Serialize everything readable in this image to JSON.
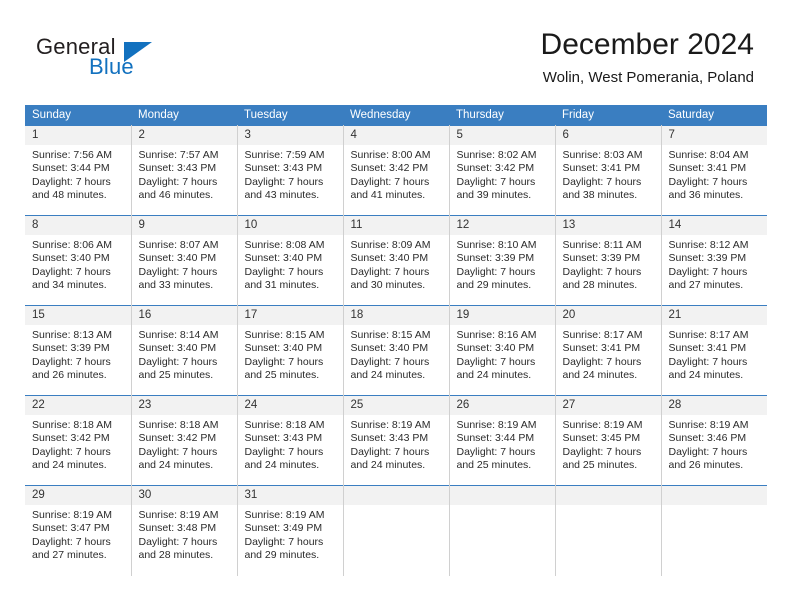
{
  "brand": {
    "name_part1": "General",
    "name_part2": "Blue",
    "triangle_icon": "triangle-icon",
    "color_dark": "#231f20",
    "color_blue": "#1271bf"
  },
  "header": {
    "title": "December 2024",
    "subtitle": "Wolin, West Pomerania, Poland"
  },
  "calendar": {
    "header_bg": "#3a7ec1",
    "daynum_bg": "#f2f2f2",
    "weekdays": [
      "Sunday",
      "Monday",
      "Tuesday",
      "Wednesday",
      "Thursday",
      "Friday",
      "Saturday"
    ],
    "labels": {
      "sunrise": "Sunrise:",
      "sunset": "Sunset:",
      "daylight": "Daylight:"
    },
    "weeks": [
      [
        {
          "day": "1",
          "sunrise": "Sunrise: 7:56 AM",
          "sunset": "Sunset: 3:44 PM",
          "daylight1": "Daylight: 7 hours",
          "daylight2": "and 48 minutes."
        },
        {
          "day": "2",
          "sunrise": "Sunrise: 7:57 AM",
          "sunset": "Sunset: 3:43 PM",
          "daylight1": "Daylight: 7 hours",
          "daylight2": "and 46 minutes."
        },
        {
          "day": "3",
          "sunrise": "Sunrise: 7:59 AM",
          "sunset": "Sunset: 3:43 PM",
          "daylight1": "Daylight: 7 hours",
          "daylight2": "and 43 minutes."
        },
        {
          "day": "4",
          "sunrise": "Sunrise: 8:00 AM",
          "sunset": "Sunset: 3:42 PM",
          "daylight1": "Daylight: 7 hours",
          "daylight2": "and 41 minutes."
        },
        {
          "day": "5",
          "sunrise": "Sunrise: 8:02 AM",
          "sunset": "Sunset: 3:42 PM",
          "daylight1": "Daylight: 7 hours",
          "daylight2": "and 39 minutes."
        },
        {
          "day": "6",
          "sunrise": "Sunrise: 8:03 AM",
          "sunset": "Sunset: 3:41 PM",
          "daylight1": "Daylight: 7 hours",
          "daylight2": "and 38 minutes."
        },
        {
          "day": "7",
          "sunrise": "Sunrise: 8:04 AM",
          "sunset": "Sunset: 3:41 PM",
          "daylight1": "Daylight: 7 hours",
          "daylight2": "and 36 minutes."
        }
      ],
      [
        {
          "day": "8",
          "sunrise": "Sunrise: 8:06 AM",
          "sunset": "Sunset: 3:40 PM",
          "daylight1": "Daylight: 7 hours",
          "daylight2": "and 34 minutes."
        },
        {
          "day": "9",
          "sunrise": "Sunrise: 8:07 AM",
          "sunset": "Sunset: 3:40 PM",
          "daylight1": "Daylight: 7 hours",
          "daylight2": "and 33 minutes."
        },
        {
          "day": "10",
          "sunrise": "Sunrise: 8:08 AM",
          "sunset": "Sunset: 3:40 PM",
          "daylight1": "Daylight: 7 hours",
          "daylight2": "and 31 minutes."
        },
        {
          "day": "11",
          "sunrise": "Sunrise: 8:09 AM",
          "sunset": "Sunset: 3:40 PM",
          "daylight1": "Daylight: 7 hours",
          "daylight2": "and 30 minutes."
        },
        {
          "day": "12",
          "sunrise": "Sunrise: 8:10 AM",
          "sunset": "Sunset: 3:39 PM",
          "daylight1": "Daylight: 7 hours",
          "daylight2": "and 29 minutes."
        },
        {
          "day": "13",
          "sunrise": "Sunrise: 8:11 AM",
          "sunset": "Sunset: 3:39 PM",
          "daylight1": "Daylight: 7 hours",
          "daylight2": "and 28 minutes."
        },
        {
          "day": "14",
          "sunrise": "Sunrise: 8:12 AM",
          "sunset": "Sunset: 3:39 PM",
          "daylight1": "Daylight: 7 hours",
          "daylight2": "and 27 minutes."
        }
      ],
      [
        {
          "day": "15",
          "sunrise": "Sunrise: 8:13 AM",
          "sunset": "Sunset: 3:39 PM",
          "daylight1": "Daylight: 7 hours",
          "daylight2": "and 26 minutes."
        },
        {
          "day": "16",
          "sunrise": "Sunrise: 8:14 AM",
          "sunset": "Sunset: 3:40 PM",
          "daylight1": "Daylight: 7 hours",
          "daylight2": "and 25 minutes."
        },
        {
          "day": "17",
          "sunrise": "Sunrise: 8:15 AM",
          "sunset": "Sunset: 3:40 PM",
          "daylight1": "Daylight: 7 hours",
          "daylight2": "and 25 minutes."
        },
        {
          "day": "18",
          "sunrise": "Sunrise: 8:15 AM",
          "sunset": "Sunset: 3:40 PM",
          "daylight1": "Daylight: 7 hours",
          "daylight2": "and 24 minutes."
        },
        {
          "day": "19",
          "sunrise": "Sunrise: 8:16 AM",
          "sunset": "Sunset: 3:40 PM",
          "daylight1": "Daylight: 7 hours",
          "daylight2": "and 24 minutes."
        },
        {
          "day": "20",
          "sunrise": "Sunrise: 8:17 AM",
          "sunset": "Sunset: 3:41 PM",
          "daylight1": "Daylight: 7 hours",
          "daylight2": "and 24 minutes."
        },
        {
          "day": "21",
          "sunrise": "Sunrise: 8:17 AM",
          "sunset": "Sunset: 3:41 PM",
          "daylight1": "Daylight: 7 hours",
          "daylight2": "and 24 minutes."
        }
      ],
      [
        {
          "day": "22",
          "sunrise": "Sunrise: 8:18 AM",
          "sunset": "Sunset: 3:42 PM",
          "daylight1": "Daylight: 7 hours",
          "daylight2": "and 24 minutes."
        },
        {
          "day": "23",
          "sunrise": "Sunrise: 8:18 AM",
          "sunset": "Sunset: 3:42 PM",
          "daylight1": "Daylight: 7 hours",
          "daylight2": "and 24 minutes."
        },
        {
          "day": "24",
          "sunrise": "Sunrise: 8:18 AM",
          "sunset": "Sunset: 3:43 PM",
          "daylight1": "Daylight: 7 hours",
          "daylight2": "and 24 minutes."
        },
        {
          "day": "25",
          "sunrise": "Sunrise: 8:19 AM",
          "sunset": "Sunset: 3:43 PM",
          "daylight1": "Daylight: 7 hours",
          "daylight2": "and 24 minutes."
        },
        {
          "day": "26",
          "sunrise": "Sunrise: 8:19 AM",
          "sunset": "Sunset: 3:44 PM",
          "daylight1": "Daylight: 7 hours",
          "daylight2": "and 25 minutes."
        },
        {
          "day": "27",
          "sunrise": "Sunrise: 8:19 AM",
          "sunset": "Sunset: 3:45 PM",
          "daylight1": "Daylight: 7 hours",
          "daylight2": "and 25 minutes."
        },
        {
          "day": "28",
          "sunrise": "Sunrise: 8:19 AM",
          "sunset": "Sunset: 3:46 PM",
          "daylight1": "Daylight: 7 hours",
          "daylight2": "and 26 minutes."
        }
      ],
      [
        {
          "day": "29",
          "sunrise": "Sunrise: 8:19 AM",
          "sunset": "Sunset: 3:47 PM",
          "daylight1": "Daylight: 7 hours",
          "daylight2": "and 27 minutes."
        },
        {
          "day": "30",
          "sunrise": "Sunrise: 8:19 AM",
          "sunset": "Sunset: 3:48 PM",
          "daylight1": "Daylight: 7 hours",
          "daylight2": "and 28 minutes."
        },
        {
          "day": "31",
          "sunrise": "Sunrise: 8:19 AM",
          "sunset": "Sunset: 3:49 PM",
          "daylight1": "Daylight: 7 hours",
          "daylight2": "and 29 minutes."
        },
        {
          "day": "",
          "sunrise": "",
          "sunset": "",
          "daylight1": "",
          "daylight2": ""
        },
        {
          "day": "",
          "sunrise": "",
          "sunset": "",
          "daylight1": "",
          "daylight2": ""
        },
        {
          "day": "",
          "sunrise": "",
          "sunset": "",
          "daylight1": "",
          "daylight2": ""
        },
        {
          "day": "",
          "sunrise": "",
          "sunset": "",
          "daylight1": "",
          "daylight2": ""
        }
      ]
    ]
  }
}
